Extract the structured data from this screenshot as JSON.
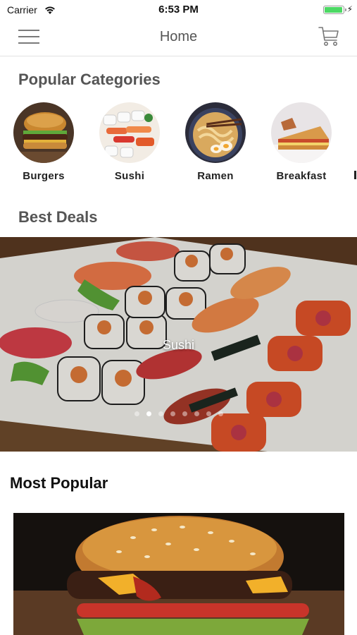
{
  "status_bar": {
    "carrier": "Carrier",
    "time": "6:53 PM",
    "battery_level": 1.0
  },
  "nav": {
    "title": "Home",
    "menu_icon": "hamburger-menu-icon",
    "cart_icon": "shopping-cart-icon"
  },
  "popular_categories": {
    "title": "Popular Categories",
    "items": [
      {
        "label": "Burgers"
      },
      {
        "label": "Sushi"
      },
      {
        "label": "Ramen"
      },
      {
        "label": "Breakfast"
      }
    ]
  },
  "best_deals": {
    "title": "Best Deals",
    "current_caption": "Sushi",
    "page_count": 8,
    "current_page": 2
  },
  "most_popular": {
    "title": "Most Popular"
  },
  "colors": {
    "accent_battery": "#4cd964",
    "heading_gray": "#555555"
  }
}
